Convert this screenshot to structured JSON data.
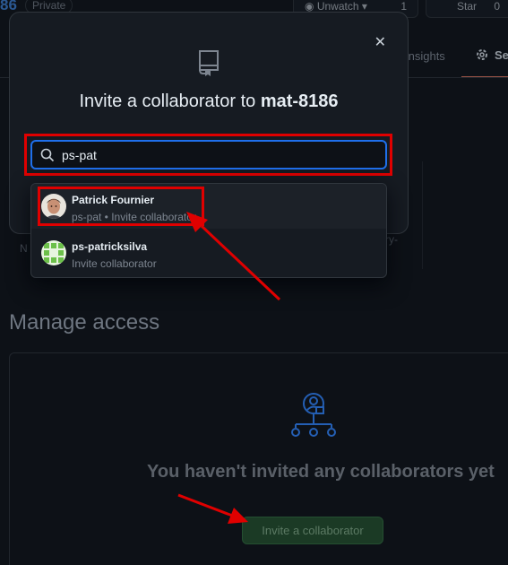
{
  "background": {
    "repo_name_fragment": "86",
    "visibility_badge": "Private",
    "watch_button": {
      "label": "Unwatch",
      "count": "1"
    },
    "star_button": {
      "label": "Star",
      "count": "0"
    },
    "tabs": {
      "insights": "Insights",
      "settings": "Se"
    },
    "section_title": "Manage access",
    "empty_state": {
      "message": "You haven't invited any collaborators yet",
      "invite_button": "Invite a collaborator"
    },
    "hidden_text_1": "N",
    "hidden_text_2": "ry-"
  },
  "modal": {
    "title_prefix": "Invite a collaborator to",
    "repo_name": "mat-8186",
    "search": {
      "value": "ps-pat",
      "placeholder": ""
    },
    "results": [
      {
        "name": "Patrick Fournier",
        "subtitle": "ps-pat • Invite collaborator"
      },
      {
        "name": "ps-patricksilva",
        "subtitle": "Invite collaborator"
      }
    ]
  },
  "annotations": {
    "highlight_color": "#e00000",
    "arrow_color": "#e00000"
  },
  "colors": {
    "background": "#0d1117",
    "modal_bg": "#161b22",
    "border": "#30363d",
    "focus_blue": "#1f6feb",
    "accent_green": "#238636",
    "identicon_green": "#6cc04a"
  }
}
